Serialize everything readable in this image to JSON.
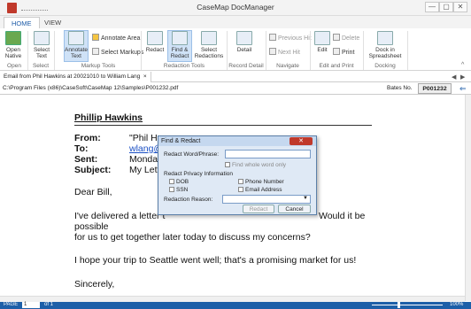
{
  "window": {
    "title": "CaseMap DocManager",
    "min": "—",
    "max": "▢",
    "close": "✕"
  },
  "tabs": [
    {
      "label": "HOME"
    },
    {
      "label": "VIEW"
    }
  ],
  "ribbon": {
    "open_native": "Open\nNative",
    "select_text": "Select\nText",
    "annotate_text": "Annotate\nText",
    "annotate_area": "Annotate Area",
    "select_markups": "Select Markups",
    "redact": "Redact",
    "find_redact": "Find &\nRedact",
    "select_redactions": "Select\nRedactions",
    "detail": "Detail",
    "previous_hit": "Previous Hit",
    "next_hit": "Next Hit",
    "edit": "Edit",
    "delete": "Delete",
    "print": "Print",
    "dock": "Dock in\nSpreadsheet",
    "groups": [
      "Open",
      "Select",
      "Markup Tools",
      "Redaction Tools",
      "Record Detail",
      "Navigate",
      "Edit and Print",
      "Docking"
    ]
  },
  "doctab": {
    "label": "Email from Phil Hawkins at 20021010 to William Lang",
    "close": "×"
  },
  "path": "C:\\Program Files (x86)\\CaseSoft\\CaseMap 12\\Samples\\P001232.pdf",
  "bates": {
    "label": "Bates No.",
    "value": "P001232"
  },
  "document": {
    "name": "Phillip Hawkins",
    "from_label": "From:",
    "from_value": "\"Phil H",
    "to_label": "To:",
    "to_value": "wlang@",
    "sent_label": "Sent:",
    "sent_value": "Monday",
    "subject_label": "Subject:",
    "subject_value": "My Lette",
    "greeting": "Dear Bill,",
    "p1a": "I've delivered a letter t",
    "p1b": "Would it be",
    "p1c": "possible",
    "p1d": "for us to get together later today to discuss my concerns?",
    "p2": "I hope your trip to Seattle went well; that's a promising market for us!",
    "p3": "Sincerely,"
  },
  "dialog": {
    "title": "Find & Redact",
    "phrase_label": "Redact Word/Phrase:",
    "phrase_value": "",
    "whole_word": "Find whole word only",
    "privacy_label": "Redact Privacy Information",
    "dob": "DOB",
    "ssn": "SSN",
    "phone": "Phone Number",
    "email": "Email Address",
    "reason_label": "Redaction Reason:",
    "reason_value": "",
    "redact_btn": "Redact",
    "cancel_btn": "Cancel"
  },
  "status": {
    "page_label": "PAGE",
    "page": "1",
    "of": "of 1",
    "zoom": "100%"
  }
}
